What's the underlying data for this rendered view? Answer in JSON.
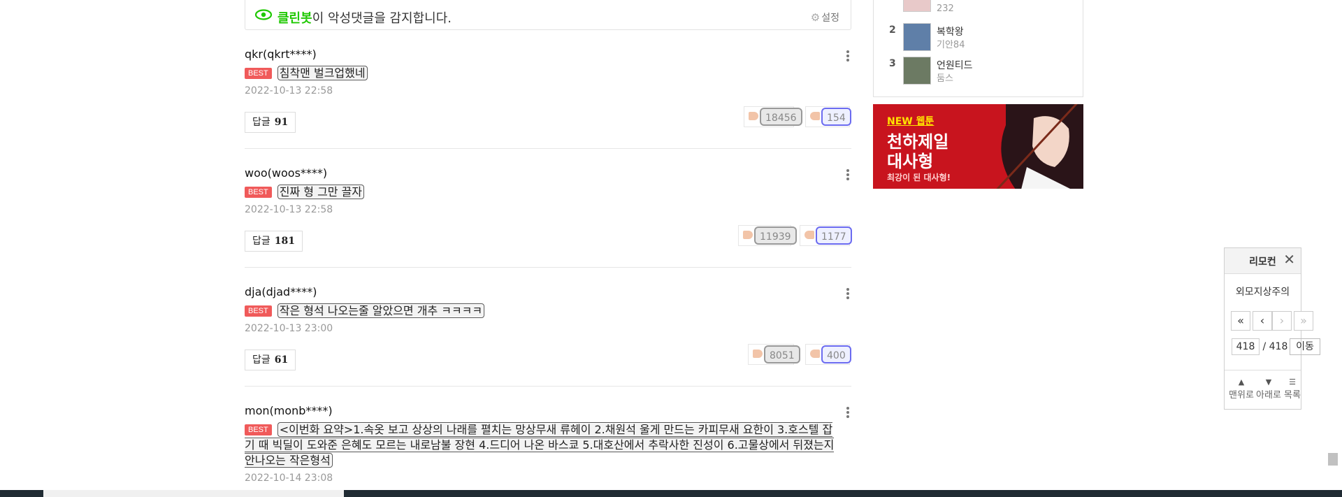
{
  "cleanbot": {
    "brand": "클린봇",
    "message": "이 악성댓글을 감지합니다.",
    "settings_label": "설정"
  },
  "comments": [
    {
      "user": "qkr(qkrt****)",
      "badge": "BEST",
      "text": "침착맨 벌크업했네",
      "date": "2022-10-13 22:58",
      "reply_label": "답글",
      "reply_count": "91",
      "likes": "18456",
      "dislikes": "154"
    },
    {
      "user": "woo(woos****)",
      "badge": "BEST",
      "text": "진짜 형 그만 끌자",
      "date": "2022-10-13 22:58",
      "reply_label": "답글",
      "reply_count": "181",
      "likes": "11939",
      "dislikes": "1177"
    },
    {
      "user": "dja(djad****)",
      "badge": "BEST",
      "text": "작은 형석 나오는줄 알았으면 개추 ㅋㅋㅋㅋ",
      "date": "2022-10-13 23:00",
      "reply_label": "답글",
      "reply_count": "61",
      "likes": "8051",
      "dislikes": "400"
    },
    {
      "user": "mon(monb****)",
      "badge": "BEST",
      "text": "<이번화 요약>1.속옷 보고 상상의 나래를 펼치는 망상무새 류헤이 2.채원석 울게 만드는 카피무새 요한이 3.호스텔 잡기 때 빅딜이 도와준 은혜도 모르는 내로남불 장현 4.드디어 나온 바스쿄 5.대호산에서 추락사한 진성이 6.고물상에서 뒤졌는지 안나오는 작은형석",
      "date": "2022-10-14 23:08"
    }
  ],
  "ranking": {
    "partial_count": "232",
    "items": [
      {
        "rank": "2",
        "title": "복학왕",
        "author": "기안84"
      },
      {
        "rank": "3",
        "title": "언원티드",
        "author": "둠스"
      }
    ]
  },
  "ad": {
    "tag": "NEW 웹툰",
    "title_line1": "천하제일",
    "title_line2": "대사형",
    "subtitle": "최강이 된 대사형!"
  },
  "remote": {
    "title": "리모컨",
    "work_title": "외모지상주의",
    "first_btn": "«",
    "prev_btn": "‹",
    "next_btn": "›",
    "last_btn": "»",
    "current_page": "418",
    "total_pages": "418",
    "page_sep": "/",
    "go_label": "이동",
    "top_label": "맨위로",
    "down_label": "아래로",
    "list_label": "목록"
  }
}
